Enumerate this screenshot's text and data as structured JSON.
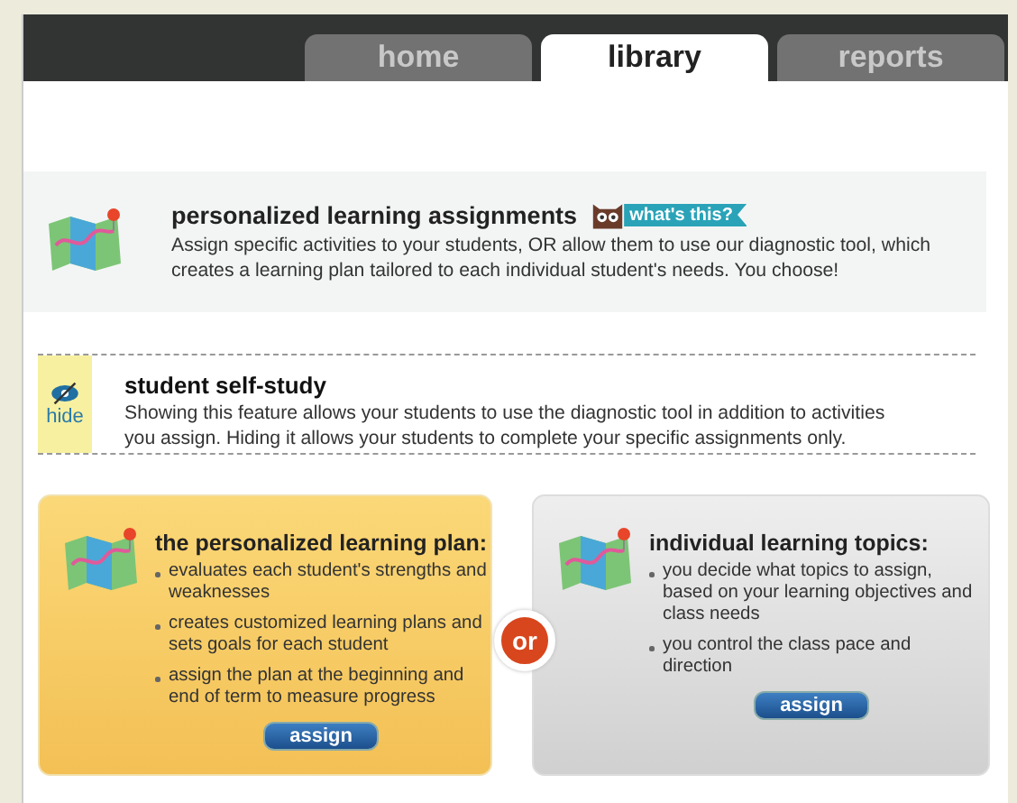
{
  "tabs": [
    {
      "label": "home",
      "selected": false
    },
    {
      "label": "library",
      "selected": true
    },
    {
      "label": "reports",
      "selected": false
    }
  ],
  "intro": {
    "title": "personalized learning assignments",
    "help_badge": "what's this?",
    "text": "Assign specific activities to your students, OR allow them to use our diagnostic tool, which creates a learning plan tailored to each individual student's needs. You choose!"
  },
  "self_study": {
    "toggle": "hide",
    "title": "student self-study",
    "text": "Showing this feature allows your students to use the diagnostic tool in addition to activities you assign. Hiding it allows your students to complete your specific assignments only."
  },
  "options": [
    {
      "kind": "highlighted",
      "title": "the personalized learning plan:",
      "bullets": [
        "evaluates each student's strengths and weaknesses",
        "creates customized learning plans and sets goals for each student",
        "assign the plan at the beginning and end of term to measure progress"
      ],
      "button": "assign"
    },
    {
      "kind": "plain",
      "title": "individual learning topics:",
      "bullets": [
        "you decide what topics to assign, based on your learning objectives and class needs",
        "you control the class pace and direction"
      ],
      "button": "assign"
    }
  ],
  "divider_label": "or"
}
